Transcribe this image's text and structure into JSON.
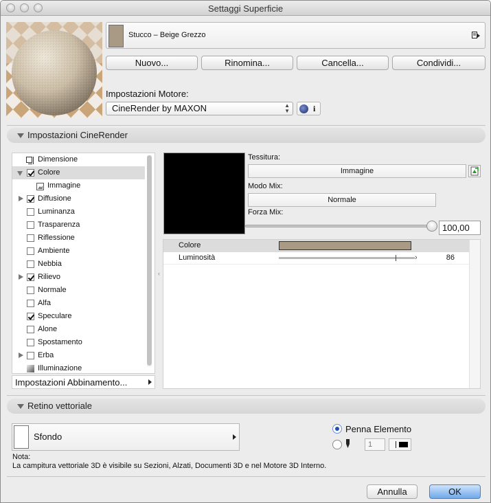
{
  "window": {
    "title": "Settaggi Superficie"
  },
  "surface": {
    "name": "Stucco – Beige Grezzo",
    "color": "#a99a85"
  },
  "buttons": {
    "new": "Nuovo...",
    "rename": "Rinomina...",
    "delete": "Cancella...",
    "share": "Condividi..."
  },
  "engine": {
    "label": "Impostazioni Motore:",
    "selected": "CineRender by MAXON",
    "info_icon": "i"
  },
  "cinerender": {
    "section_title": "Impostazioni CineRender",
    "channels": [
      {
        "label": "Dimensione",
        "icon": "dimension-icon"
      },
      {
        "label": "Colore",
        "checked": true,
        "expanded": true,
        "selected": true
      },
      {
        "label": "Immagine",
        "icon": "image-icon"
      },
      {
        "label": "Diffusione",
        "checked": true,
        "expandable": true
      },
      {
        "label": "Luminanza",
        "checked": false
      },
      {
        "label": "Trasparenza",
        "checked": false
      },
      {
        "label": "Riflessione",
        "checked": false
      },
      {
        "label": "Ambiente",
        "checked": false
      },
      {
        "label": "Nebbia",
        "checked": false
      },
      {
        "label": "Rilievo",
        "checked": true,
        "expandable": true
      },
      {
        "label": "Normale",
        "checked": false
      },
      {
        "label": "Alfa",
        "checked": false
      },
      {
        "label": "Speculare",
        "checked": true
      },
      {
        "label": "Alone",
        "checked": false
      },
      {
        "label": "Spostamento",
        "checked": false
      },
      {
        "label": "Erba",
        "checked": false,
        "expandable": true
      },
      {
        "label": "Illuminazione",
        "icon": "lighting-icon"
      }
    ],
    "match_settings": "Impostazioni Abbinamento...",
    "texture_label": "Tessitura:",
    "texture_value": "Immagine",
    "mix_mode_label": "Modo Mix:",
    "mix_mode_value": "Normale",
    "mix_strength_label": "Forza Mix:",
    "mix_strength_value": "100,00",
    "mix_strength_fraction": 1.0,
    "properties": [
      {
        "name": "Colore",
        "color": "#a99a85"
      },
      {
        "name": "Luminosità",
        "value": "86",
        "level": 0.86
      }
    ]
  },
  "vector": {
    "section_title": "Retino vettoriale",
    "fill_name": "Sfondo",
    "pen_element": "Penna Elemento",
    "pen_number": "1",
    "note_label": "Nota:",
    "note_text": "La campitura vettoriale 3D è visibile su Sezioni, Alzati, Documenti 3D e nel Motore 3D Interno."
  },
  "footer": {
    "cancel": "Annulla",
    "ok": "OK"
  }
}
